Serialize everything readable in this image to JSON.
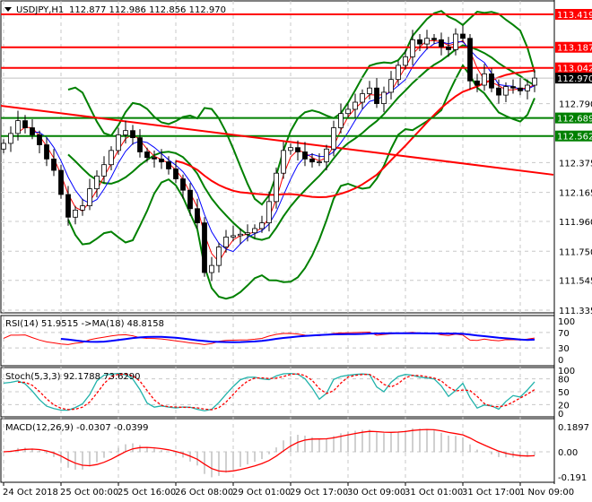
{
  "header": {
    "symbol": "USDJPY,H1",
    "ohlc": "112.877 112.986 112.856 112.970"
  },
  "price_axis": {
    "ticks": [
      "113.419",
      "113.187",
      "113.042",
      "112.970",
      "112.790",
      "112.689",
      "112.562",
      "112.375",
      "112.165",
      "111.960",
      "111.750",
      "111.545",
      "111.335"
    ]
  },
  "chart_data": {
    "type": "candlestick",
    "symbol": "USDJPY",
    "timeframe": "H1",
    "ylim": [
      111.335,
      113.419
    ],
    "closes": [
      112.51,
      112.58,
      112.67,
      112.62,
      112.57,
      112.5,
      112.4,
      112.32,
      112.15,
      111.99,
      112.04,
      112.07,
      112.19,
      112.28,
      112.36,
      112.46,
      112.57,
      112.6,
      112.55,
      112.45,
      112.41,
      112.4,
      112.38,
      112.33,
      112.26,
      112.18,
      112.05,
      111.95,
      111.6,
      111.65,
      111.78,
      111.85,
      111.86,
      111.87,
      111.88,
      111.91,
      111.95,
      112.1,
      112.3,
      112.46,
      112.48,
      112.45,
      112.4,
      112.38,
      112.38,
      112.47,
      112.62,
      112.72,
      112.75,
      112.8,
      112.86,
      112.9,
      112.79,
      112.87,
      112.96,
      113.06,
      113.12,
      113.24,
      113.21,
      113.25,
      113.24,
      113.19,
      113.17,
      113.28,
      113.25,
      112.95,
      112.92,
      113.0,
      112.9,
      112.85,
      112.91,
      112.9,
      112.88,
      112.92,
      112.97
    ],
    "current_price": 112.97,
    "levels": [
      {
        "price": 113.419,
        "label": "113.419",
        "color": "#ff0000"
      },
      {
        "price": 113.187,
        "label": "113.187",
        "color": "#ff0000"
      },
      {
        "price": 113.042,
        "label": "113.042",
        "color": "#ff0000"
      },
      {
        "price": 112.689,
        "label": "112.689",
        "color": "#008000"
      },
      {
        "price": 112.562,
        "label": "112.562",
        "color": "#008000"
      }
    ],
    "trendline": {
      "from": 112.775,
      "to": 112.289,
      "color": "#ff0000"
    },
    "x_ticks": [
      "24 Oct 2018",
      "25 Oct 00:00",
      "25 Oct 16:00",
      "26 Oct 08:00",
      "29 Oct 01:00",
      "29 Oct 17:00",
      "30 Oct 09:00",
      "31 Oct 01:00",
      "31 Oct 17:00",
      "1 Nov 09:00"
    ],
    "indicators": {
      "rsi": {
        "label": "RSI(14) 51.9515  ->MA(18) 48.8158",
        "ticks": [
          "100",
          "70",
          "30",
          "0"
        ]
      },
      "stoch": {
        "label": "Stoch(5,3,3) 92.1788 73.6290",
        "ticks": [
          "100",
          "80",
          "50",
          "20",
          "0"
        ]
      },
      "macd": {
        "label": "MACD(12,26,9) -0.0307 -0.0399",
        "ticks": [
          "0.1897",
          "0.00",
          "-0.191"
        ]
      }
    },
    "colors": {
      "bands": "#008000",
      "fast_ma": "#ff0000",
      "slow_ma": "#0000ff",
      "stoch_main": "#20b2aa",
      "signal": "#ff0000",
      "histogram": "#c0c0c0"
    }
  }
}
